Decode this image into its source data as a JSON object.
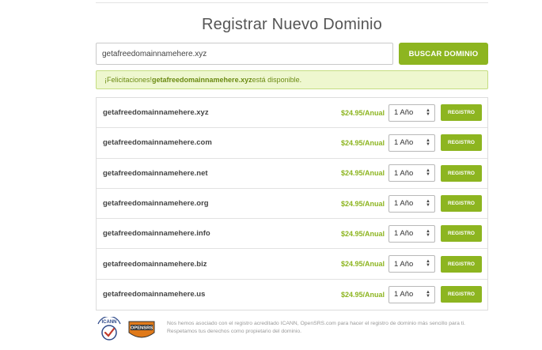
{
  "page": {
    "title": "Registrar Nuevo Dominio"
  },
  "search": {
    "value": "getafreedomainnamehere.xyz",
    "button_label": "BUSCAR DOMINIO"
  },
  "alert": {
    "prefix": "¡Felicitaciones! ",
    "domain": "getafreedomainnamehere.xyz",
    "suffix": " está disponible."
  },
  "results": [
    {
      "domain": "getafreedomainnamehere.xyz",
      "price": "$24.95/Anual",
      "term": "1 Año",
      "button": "REGISTRO"
    },
    {
      "domain": "getafreedomainnamehere.com",
      "price": "$24.95/Anual",
      "term": "1 Año",
      "button": "REGISTRO"
    },
    {
      "domain": "getafreedomainnamehere.net",
      "price": "$24.95/Anual",
      "term": "1 Año",
      "button": "REGISTRO"
    },
    {
      "domain": "getafreedomainnamehere.org",
      "price": "$24.95/Anual",
      "term": "1 Año",
      "button": "REGISTRO"
    },
    {
      "domain": "getafreedomainnamehere.info",
      "price": "$24.95/Anual",
      "term": "1 Año",
      "button": "REGISTRO"
    },
    {
      "domain": "getafreedomainnamehere.biz",
      "price": "$24.95/Anual",
      "term": "1 Año",
      "button": "REGISTRO"
    },
    {
      "domain": "getafreedomainnamehere.us",
      "price": "$24.95/Anual",
      "term": "1 Año",
      "button": "REGISTRO"
    }
  ],
  "footer": {
    "text": "Nos hemos asociado con el registro acreditado ICANN, OpenSRS.com para hacer el registro de dominio más sencillo para ti. Respetamos tus derechos como propietario del dominio.",
    "logos": {
      "icann": "ICANN",
      "opensrs": "OPENSRS"
    }
  },
  "colors": {
    "accent": "#8db520",
    "alert_bg": "#eef7cf",
    "alert_text": "#6b8a12"
  }
}
